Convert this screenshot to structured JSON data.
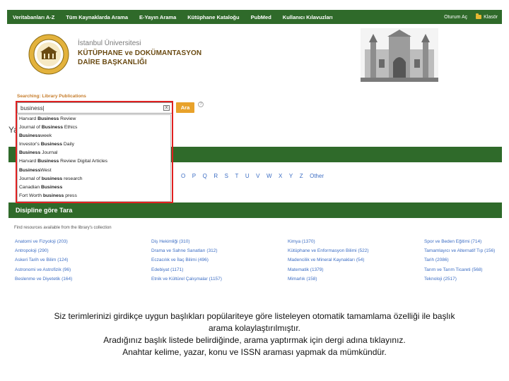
{
  "topnav": {
    "items": [
      "Veritabanları A-Z",
      "Tüm Kaynaklarda Arama",
      "E-Yayın Arama",
      "Kütüphane Kataloğu",
      "PubMed",
      "Kullanıcı Kılavuzları"
    ],
    "right_items": [
      "Oturum Aç",
      "Klasör"
    ]
  },
  "brand": {
    "line1": "İstanbul Üniversitesi",
    "line2": "KÜTÜPHANE ve DOKÜMANTASYON",
    "line3": "DAİRE BAŞKANLIĞI"
  },
  "search": {
    "label": "Searching: Library Publications",
    "value": "business|",
    "button": "Ara",
    "help": "?",
    "clear": "x"
  },
  "dropdown": [
    {
      "pre": "Harvard ",
      "bold": "Business",
      "post": " Review"
    },
    {
      "pre": "Journal of ",
      "bold": "Business",
      "post": " Ethics"
    },
    {
      "pre": "",
      "bold": "Business",
      "post": "week"
    },
    {
      "pre": "Investor's ",
      "bold": "Business",
      "post": " Daily"
    },
    {
      "pre": "",
      "bold": "Business",
      "post": " Journal"
    },
    {
      "pre": "Harvard ",
      "bold": "Business",
      "post": " Review Digital Articles"
    },
    {
      "pre": "",
      "bold": "Business",
      "post": "West"
    },
    {
      "pre": "Journal of ",
      "bold": "business",
      "post": " research"
    },
    {
      "pre": "Canadian ",
      "bold": "Business",
      "post": ""
    },
    {
      "pre": "Fort Worth ",
      "bold": "business",
      "post": " press"
    }
  ],
  "background": {
    "partial_heading": "Ya",
    "az_letters": [
      "O",
      "P",
      "Q",
      "R",
      "S",
      "T",
      "U",
      "V",
      "W",
      "X",
      "Y",
      "Z",
      "Other"
    ],
    "discipline_title": "Disipline göre Tara",
    "discipline_sub": "Find resources available from the library's collection",
    "columns": [
      [
        "Anatomi ve Fizyoloji (203)",
        "Antropoloji (290)",
        "Askeri Tarih ve Bilim (124)",
        "Astronomi ve Astrofizik (96)",
        "Beslenme ve Diyetetik (164)"
      ],
      [
        "Diş Hekimliği (310)",
        "Drama ve Sahne Sanatları (312)",
        "Eczacılık ve İlaç Bilimi (496)",
        "Edebiyat (1171)",
        "Etnik ve Kültürel Çalışmalar (1157)"
      ],
      [
        "Kimya (1370)",
        "Kütüphane ve Enformasyon Bilimi (522)",
        "Madencilik ve Mineral Kaynakları (54)",
        "Matematik (1379)",
        "Mimarlık (158)"
      ],
      [
        "Spor ve Beden Eğitimi (714)",
        "Tamamlayıcı ve Alternatif Tıp (156)",
        "Tarih (2086)",
        "Tarım ve Tarım Ticareti (568)",
        "Teknoloji (2517)"
      ]
    ]
  },
  "caption": {
    "line1": "Siz terimlerinizi girdikçe uygun başlıkları popülariteye göre listeleyen otomatik tamamlama özelliği ile başlık",
    "line2": "arama kolaylaştırılmıştır.",
    "line3": "Aradığınız başlık listede belirdiğinde, arama yaptırmak için dergi adına tıklayınız.",
    "line4": "Anahtar kelime, yazar, konu ve ISSN araması yapmak da mümkündür."
  },
  "colors": {
    "nav_green": "#2f6a2a",
    "accent_orange": "#e8a22b",
    "highlight_red": "#e02020",
    "link_blue": "#3d6ec4"
  }
}
